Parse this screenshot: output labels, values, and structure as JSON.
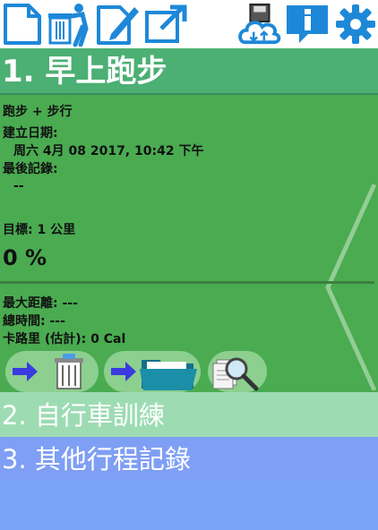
{
  "colors": {
    "header_green": "#4caf73",
    "card_green": "#4aab51",
    "row2_bg": "#9ddcb3",
    "row3_bg": "#7f9ff5",
    "icon_blue": "#1e88d8"
  },
  "toolbar": {
    "icons": [
      "new-document-icon",
      "trash-person-icon",
      "edit-icon",
      "export-icon",
      "cloud-sync-icon",
      "info-icon",
      "settings-icon"
    ]
  },
  "card": {
    "title": "1. 早上跑步",
    "type": "跑步 + 步行",
    "created_label": "建立日期:",
    "created_value": "周六 4月 08  2017, 10:42 下午",
    "last_record_label": "最後記錄:",
    "last_record_value": "--",
    "goal": "目標: 1 公里",
    "progress": "0 %",
    "max_distance": "最大距離:  ---",
    "total_time": "總時間: ---",
    "calories": "卡路里 (估計): 0 Cal"
  },
  "list": {
    "item2": "2. 自行車訓練",
    "item3": "3. 其他行程記錄"
  }
}
